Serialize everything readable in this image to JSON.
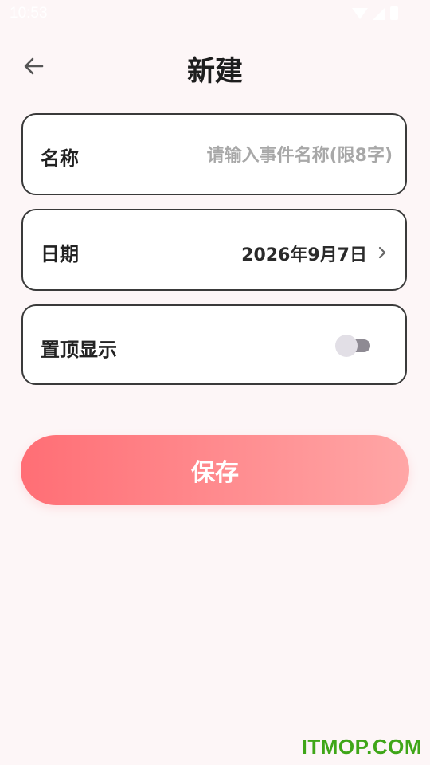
{
  "status_bar": {
    "time": "10:53",
    "icons": [
      "wifi-icon",
      "signal-icon",
      "battery-icon"
    ]
  },
  "header": {
    "title": "新建",
    "back_icon": "arrow-left-icon"
  },
  "form": {
    "name": {
      "label": "名称",
      "value": "",
      "placeholder": "请输入事件名称(限8字)"
    },
    "date": {
      "label": "日期",
      "value": "2026年9月7日",
      "icon": "chevron-right-icon"
    },
    "pin": {
      "label": "置顶显示",
      "enabled": false
    }
  },
  "save_button": {
    "label": "保存"
  },
  "watermark": "ITMOP.COM",
  "colors": {
    "background": "#fdf6f7",
    "gradient_start": "#ff6e75",
    "gradient_end": "#ffa6a6",
    "watermark": "#3fa618",
    "card_border": "#3a3a3a",
    "placeholder": "#a8a8a8"
  }
}
